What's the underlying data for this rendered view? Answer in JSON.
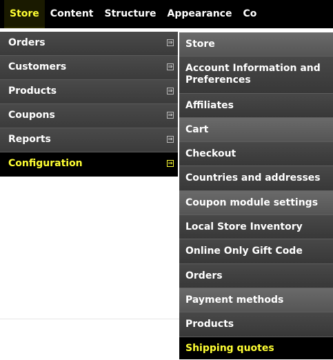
{
  "topbar": {
    "items": [
      {
        "label": "Store"
      },
      {
        "label": "Content"
      },
      {
        "label": "Structure"
      },
      {
        "label": "Appearance"
      },
      {
        "label": "Co"
      }
    ]
  },
  "menu1": {
    "items": [
      {
        "label": "Orders"
      },
      {
        "label": "Customers"
      },
      {
        "label": "Products"
      },
      {
        "label": "Coupons"
      },
      {
        "label": "Reports"
      },
      {
        "label": "Configuration"
      }
    ],
    "arrow_glyph": "⇒"
  },
  "menu2": {
    "items": [
      {
        "label": "Store"
      },
      {
        "label": "Account Information and Preferences"
      },
      {
        "label": "Affiliates"
      },
      {
        "label": "Cart"
      },
      {
        "label": "Checkout"
      },
      {
        "label": "Countries and addresses"
      },
      {
        "label": "Coupon module settings"
      },
      {
        "label": "Local Store Inventory"
      },
      {
        "label": "Online Only Gift Code"
      },
      {
        "label": "Orders"
      },
      {
        "label": "Payment methods"
      },
      {
        "label": "Products"
      },
      {
        "label": "Shipping quotes"
      }
    ]
  },
  "colors": {
    "active_text": "#ffff33",
    "menu_bg": "#3b3b3b",
    "menu_bg_light": "#555555",
    "topbar_bg": "#000000"
  }
}
